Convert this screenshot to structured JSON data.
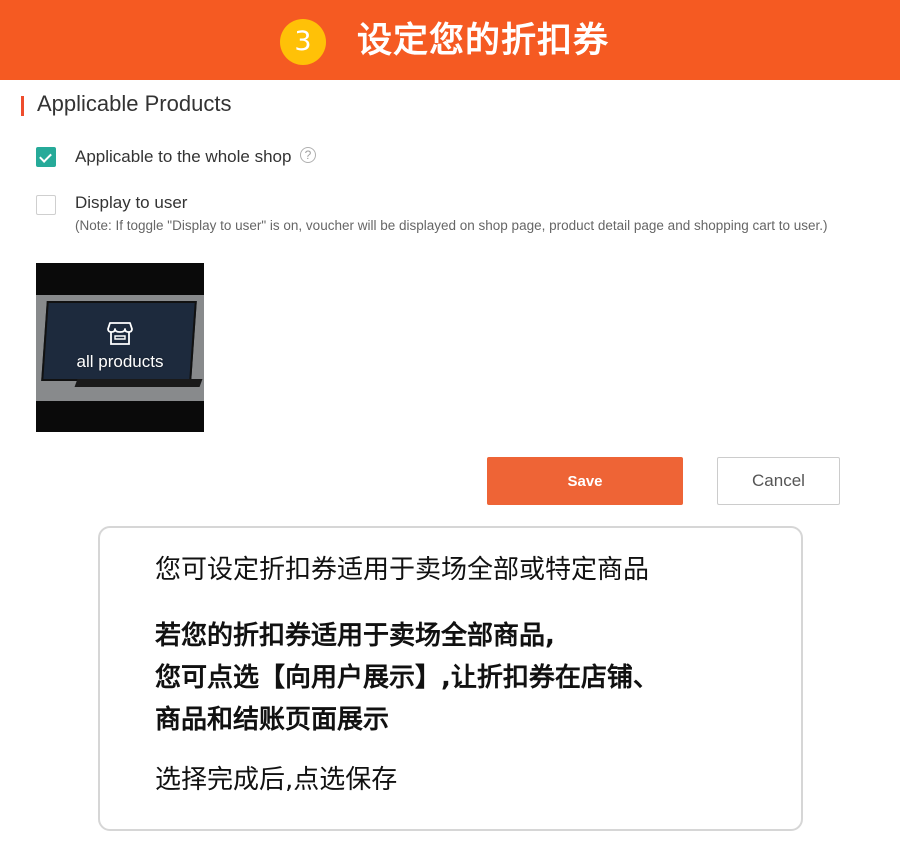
{
  "banner": {
    "step_number": "3",
    "title": "设定您的折扣券",
    "background_color": "#f55a22",
    "step_circle_color": "#ffc107"
  },
  "section": {
    "title": "Applicable Products"
  },
  "options": {
    "whole_shop": {
      "label": "Applicable to the whole shop",
      "checked": true,
      "help_icon": "?"
    },
    "display_to_user": {
      "label": "Display to user",
      "checked": false,
      "note": "(Note: If toggle \"Display to user\" is on, voucher will be displayed on shop page, product detail page and shopping cart to user.)"
    }
  },
  "product_card": {
    "label": "all products",
    "icon": "shop-icon"
  },
  "buttons": {
    "save": "Save",
    "cancel": "Cancel",
    "save_color": "#ee6436"
  },
  "info_box": {
    "line1": "您可设定折扣券适用于卖场全部或特定商品",
    "line2": "若您的折扣券适用于卖场全部商品,",
    "line3": "您可点选【向用户展示】,让折扣券在店铺、",
    "line4": "商品和结账页面展示",
    "line5": "选择完成后,点选保存"
  }
}
